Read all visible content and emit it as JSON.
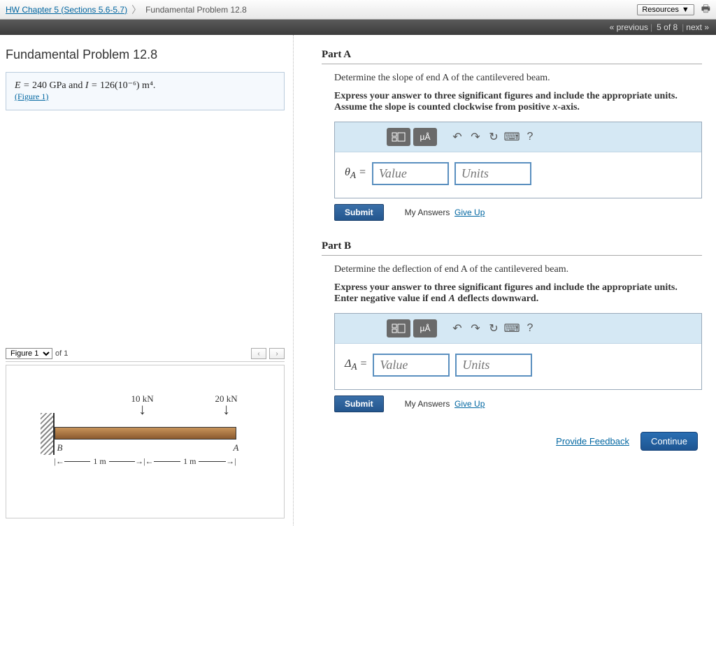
{
  "breadcrumb": {
    "link": "HW Chapter 5 (Sections 5.6-5.7)",
    "current": "Fundamental Problem 12.8"
  },
  "topbar": {
    "resources": "Resources"
  },
  "nav": {
    "previous": "« previous",
    "position": "5 of 8",
    "next": "next »"
  },
  "problem": {
    "title": "Fundamental Problem 12.8",
    "given_prefix": "E = ",
    "E_value": "240",
    "E_unit": " GPa",
    "given_mid": " and ",
    "I_prefix": "I = ",
    "I_value": "126(10⁻⁶) m⁴",
    "given_suffix": ".",
    "figure_link": "(Figure 1)"
  },
  "partA": {
    "header": "Part A",
    "desc": "Determine the slope of end A of the cantilevered beam.",
    "instr": "Express your answer to three significant figures and include the appropriate units. Assume the slope is counted clockwise from positive x-axis.",
    "var": "θ_A =",
    "value_ph": "Value",
    "units_ph": "Units",
    "toolbar_units": "µÅ"
  },
  "partB": {
    "header": "Part B",
    "desc": "Determine the deflection of end A of the cantilevered beam.",
    "instr": "Express your answer to three significant figures and include the appropriate units. Enter negative value if end A deflects downward.",
    "var": "Δ_A =",
    "value_ph": "Value",
    "units_ph": "Units",
    "toolbar_units": "µÅ"
  },
  "controls": {
    "submit": "Submit",
    "my_answers": "My Answers",
    "give_up": "Give Up",
    "provide_feedback": "Provide Feedback",
    "continue": "Continue",
    "help": "?"
  },
  "figure": {
    "selector": "Figure 1",
    "of": "of 1",
    "load1": "10 kN",
    "load2": "20 kN",
    "dim1": "1 m",
    "dim2": "1 m",
    "ptB": "B",
    "ptA": "A"
  },
  "chart_data": {
    "type": "diagram",
    "description": "Cantilever beam fixed at B (left wall), free at A (right). Two downward point loads.",
    "E_GPa": 240,
    "I_m4": 0.000126,
    "loads": [
      {
        "position_m_from_B": 1,
        "force_kN": 10,
        "direction": "down"
      },
      {
        "position_m_from_B": 2,
        "force_kN": 20,
        "direction": "down"
      }
    ],
    "span_segments_m": [
      1,
      1
    ],
    "total_length_m": 2,
    "fixed_end": "B",
    "free_end": "A"
  }
}
